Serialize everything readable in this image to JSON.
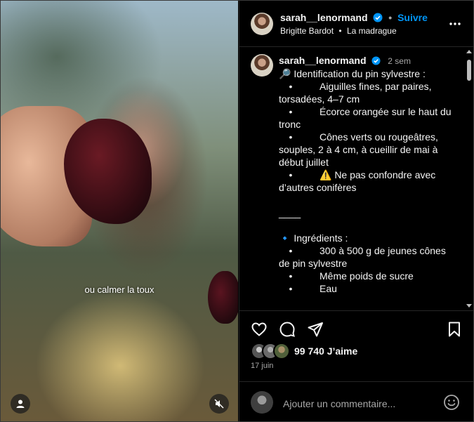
{
  "media": {
    "subtitle": "ou calmer la toux"
  },
  "header": {
    "username": "sarah__lenormand",
    "separator": "•",
    "follow_label": "Suivre",
    "subtitle_artist": "Brigitte Bardot",
    "subtitle_sep": "•",
    "subtitle_track": "La madrague"
  },
  "caption": {
    "username": "sarah__lenormand",
    "time": "2 sem",
    "lines": [
      "🔎 Identification du pin sylvestre :",
      "•",
      "Aiguilles fines, par paires,",
      "torsadées, 4–7 cm",
      "•",
      "Écorce orangée sur le haut du",
      "tronc",
      "•",
      "Cônes verts ou rougeâtres,",
      "souples, 2 à 4 cm, à cueillir de mai à",
      "début juillet",
      "•",
      "⚠️ Ne pas confondre avec",
      "d’autres conifères",
      "____",
      "🔹 Ingrédients :",
      "•",
      "300 à 500 g de jeunes cônes",
      "de pin sylvestre",
      "•",
      "Même poids de sucre",
      "•",
      "Eau"
    ]
  },
  "engagement": {
    "likes": "99 740 J’aime",
    "date": "17 juin"
  },
  "comment": {
    "placeholder": "Ajouter un commentaire..."
  },
  "colors": {
    "accent": "#0095f6",
    "background": "#000000",
    "text": "#f5f5f5",
    "muted": "#a8a8a8"
  },
  "icons": [
    "user-icon",
    "mute-icon",
    "verified-icon",
    "more-icon",
    "heart-icon",
    "comment-icon",
    "share-icon",
    "bookmark-icon",
    "emoji-icon"
  ]
}
